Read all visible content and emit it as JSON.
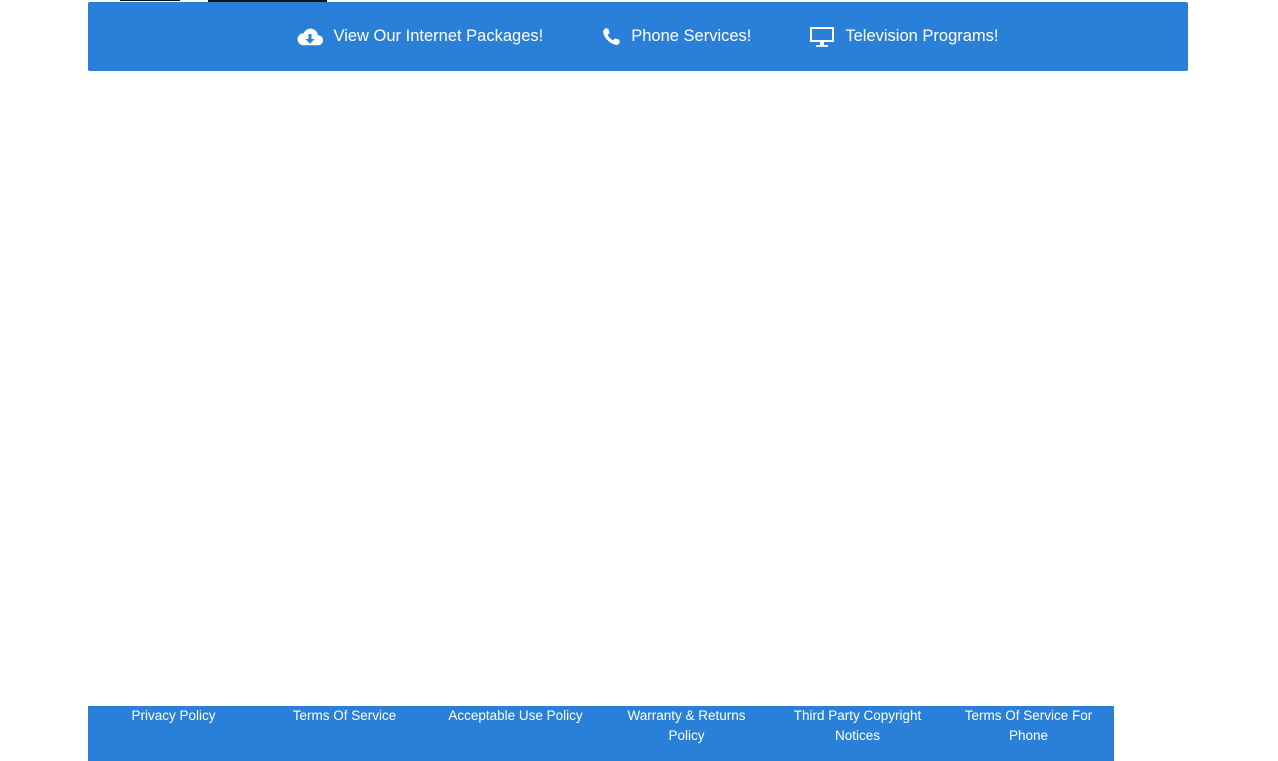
{
  "nav": {
    "items": [
      {
        "label": "View Our Internet Packages!",
        "icon": "cloud-download-icon"
      },
      {
        "label": "Phone Services!",
        "icon": "phone-icon"
      },
      {
        "label": "Television Programs!",
        "icon": "monitor-icon"
      }
    ]
  },
  "footer": {
    "links": [
      {
        "label": "Privacy Policy"
      },
      {
        "label": "Terms Of Service"
      },
      {
        "label": "Acceptable Use Policy"
      },
      {
        "label": "Warranty & Returns Policy"
      },
      {
        "label": "Third Party Copyright Notices"
      },
      {
        "label": "Terms Of Service For Phone"
      }
    ]
  },
  "colors": {
    "brand_blue": "#2a80d8",
    "text_on_brand": "#ffffff"
  }
}
